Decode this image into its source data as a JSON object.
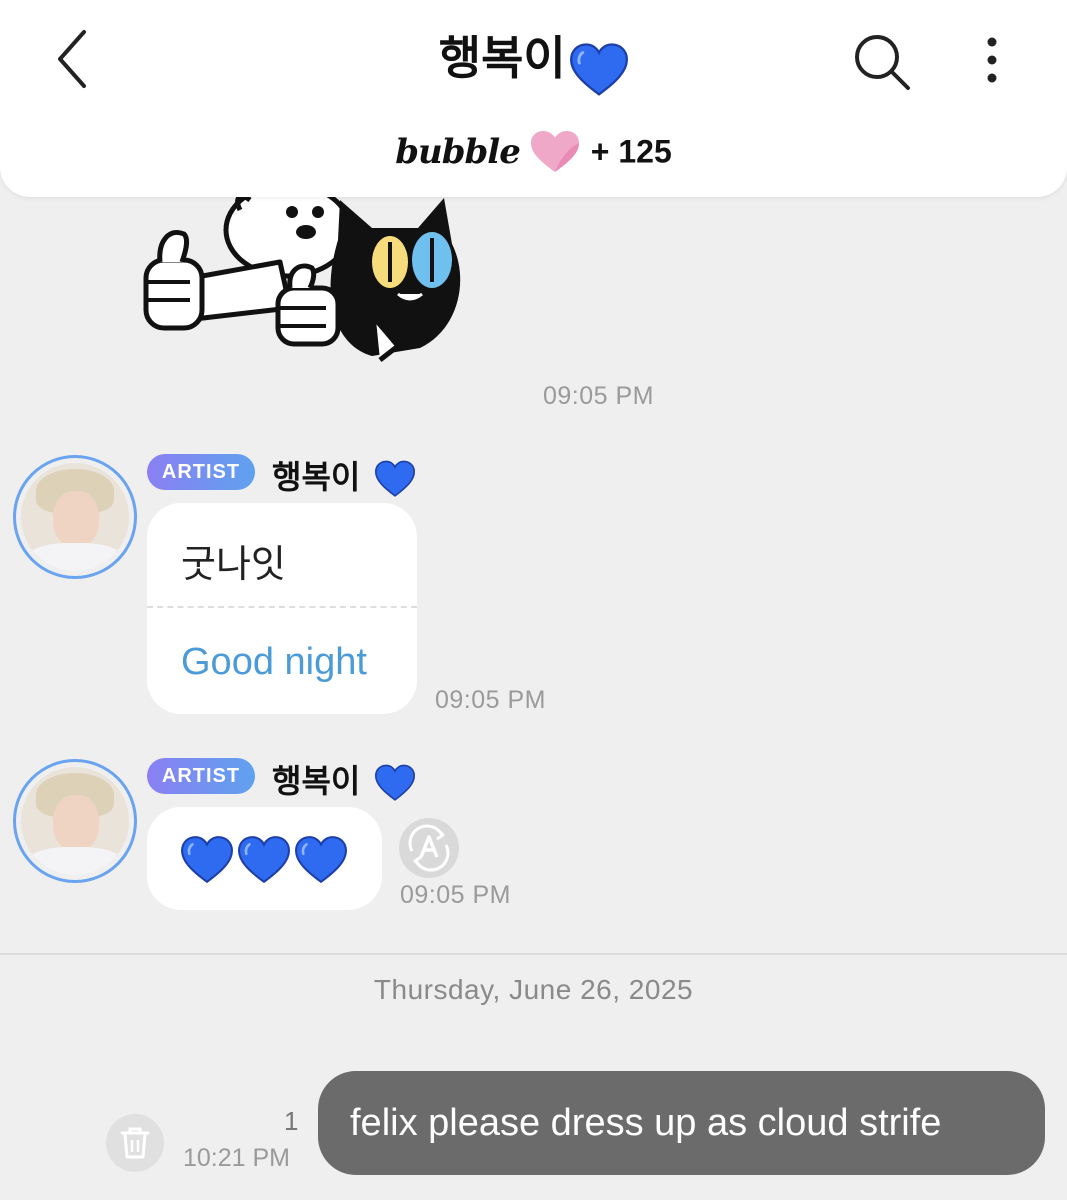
{
  "header": {
    "title": "행복이",
    "title_emoji": "blue-heart",
    "bubble_brand": "bubble",
    "bubble_count": "+ 125"
  },
  "messages": [
    {
      "type": "sticker",
      "time": "09:05 PM"
    },
    {
      "type": "translated-text",
      "badge": "ARTIST",
      "sender": "행복이",
      "original": "굿나잇",
      "translation": "Good night",
      "time": "09:05 PM"
    },
    {
      "type": "emoji",
      "badge": "ARTIST",
      "sender": "행복이",
      "emoji_count": 3,
      "time": "09:05 PM"
    }
  ],
  "date_divider": "Thursday, June 26, 2025",
  "outgoing": {
    "text": "felix please dress up as cloud strife",
    "unread_count": "1",
    "time": "10:21 PM"
  },
  "colors": {
    "accent_blue": "#4a9bd8",
    "avatar_ring": "#6aa3ef",
    "badge_gradient_start": "#8b7ff3",
    "badge_gradient_end": "#5fa2ef",
    "outgoing_bubble": "#6b6b6b",
    "background": "#efefef"
  },
  "icons": {
    "back": "chevron-left-icon",
    "search": "search-icon",
    "more": "more-vertical-icon",
    "translate": "translate-icon",
    "delete": "trash-icon"
  }
}
